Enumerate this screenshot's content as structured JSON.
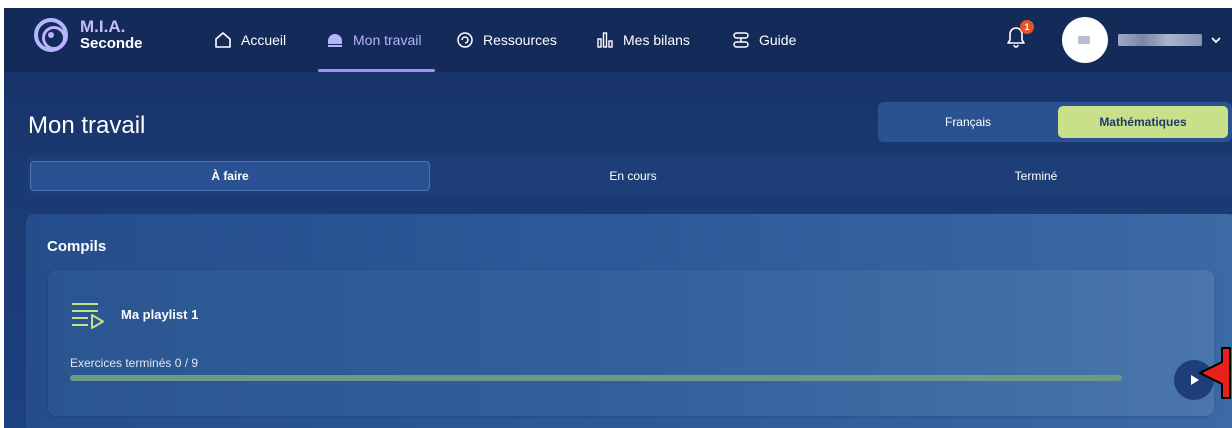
{
  "app": {
    "brand_line1": "M.I.A.",
    "brand_line2": "Seconde"
  },
  "nav": {
    "items": [
      {
        "label": "Accueil",
        "icon": "home-icon"
      },
      {
        "label": "Mon travail",
        "icon": "work-icon",
        "active": true
      },
      {
        "label": "Ressources",
        "icon": "resources-icon"
      },
      {
        "label": "Mes bilans",
        "icon": "chart-icon"
      },
      {
        "label": "Guide",
        "icon": "guide-icon"
      }
    ],
    "notifications_count": "1"
  },
  "page": {
    "title": "Mon travail"
  },
  "subjects": {
    "options": [
      "Français",
      "Mathématiques"
    ],
    "selected": "Mathématiques"
  },
  "tabs": {
    "items": [
      "À faire",
      "En cours",
      "Terminé"
    ],
    "selected": "À faire"
  },
  "compils": {
    "title": "Compils",
    "playlist": {
      "title": "Ma playlist 1",
      "progress_label": "Exercices terminés 0 / 9",
      "completed": 0,
      "total": 9,
      "progress_fraction": 0
    }
  },
  "colors": {
    "accent_purple": "#b9b3ff",
    "accent_green": "#c8e08a",
    "background": "#1a3a72",
    "annotation_red": "#e8221b"
  }
}
